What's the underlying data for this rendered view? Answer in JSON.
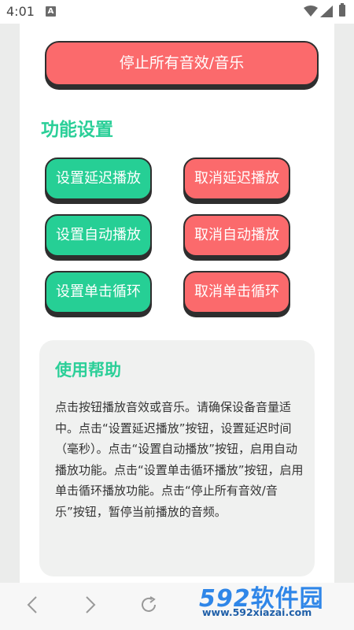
{
  "status_bar": {
    "time": "4:01",
    "notification_icon": "A"
  },
  "stop_all_label": "停止所有音效/音乐",
  "section_title": "功能设置",
  "buttons": {
    "set_delay": "设置延迟播放",
    "cancel_delay": "取消延迟播放",
    "set_auto": "设置自动播放",
    "cancel_auto": "取消自动播放",
    "set_loop": "设置单击循环",
    "cancel_loop": "取消单击循环"
  },
  "help": {
    "title": "使用帮助",
    "body": "点击按钮播放音效或音乐。请确保设备音量适中。点击“设置延迟播放”按钮，设置延迟时间（毫秒）。点击“设置自动播放”按钮，启用自动播放功能。点击“设置单击循环播放”按钮，启用单击循环播放功能。点击“停止所有音效/音乐”按钮，暂停当前播放的音频。"
  },
  "watermark": {
    "logo_num": "592",
    "logo_text": "软件园",
    "url": "www.592xiazai.com"
  },
  "colors": {
    "green": "#26cf95",
    "red": "#fb6a6c",
    "title_green": "#2bcf98"
  }
}
